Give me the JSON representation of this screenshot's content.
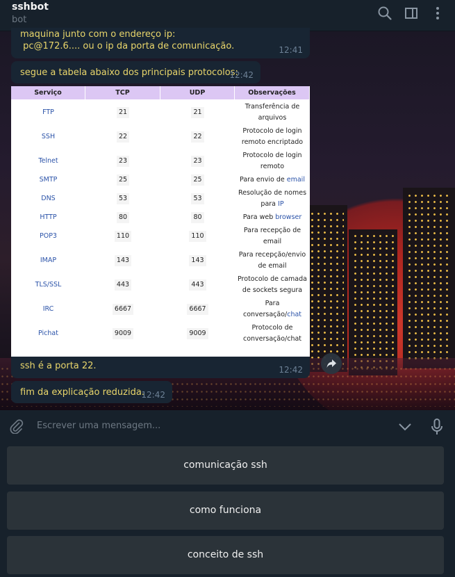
{
  "header": {
    "title": "sshbot",
    "subtitle": "bot"
  },
  "messages": [
    {
      "text": "maquina junto com o endereço ip:\n pc@172.6.... ou o ip da porta de comunicação.",
      "time": "12:41"
    },
    {
      "text": "segue a tabela abaixo dos principais protocolos:",
      "time": "12:42"
    },
    {
      "text": "ssh é a porta 22.",
      "time": "12:42"
    },
    {
      "text": "fim da explicação reduzida.",
      "time": "12:42"
    }
  ],
  "table": {
    "headers": [
      "Serviço",
      "TCP",
      "UDP",
      "Observações"
    ],
    "rows": [
      {
        "service": "FTP",
        "tcp": "21",
        "udp": "21",
        "obs1": "Transferência de",
        "obs2": "arquivos",
        "obs_link": ""
      },
      {
        "service": "SSH",
        "tcp": "22",
        "udp": "22",
        "obs1": "Protocolo de login",
        "obs2": "remoto encriptado",
        "obs_link": ""
      },
      {
        "service": "Telnet",
        "tcp": "23",
        "udp": "23",
        "obs1": "Protocolo de login",
        "obs2": "remoto",
        "obs_link": ""
      },
      {
        "service": "SMTP",
        "tcp": "25",
        "udp": "25",
        "obs1": "Para envio de ",
        "obs2": "",
        "obs_link": "email"
      },
      {
        "service": "DNS",
        "tcp": "53",
        "udp": "53",
        "obs1": "Resolução de nomes",
        "obs2": "para ",
        "obs_link": "IP"
      },
      {
        "service": "HTTP",
        "tcp": "80",
        "udp": "80",
        "obs1": "Para web ",
        "obs2": "",
        "obs_link": "browser"
      },
      {
        "service": "POP3",
        "tcp": "110",
        "udp": "110",
        "obs1": "Para recepção de",
        "obs2": "email",
        "obs_link": ""
      },
      {
        "service": "IMAP",
        "tcp": "143",
        "udp": "143",
        "obs1": "Para recepção/envio",
        "obs2": "de email",
        "obs_link": ""
      },
      {
        "service": "TLS/SSL",
        "tcp": "443",
        "udp": "443",
        "obs1": "Protocolo de camada",
        "obs2": "de sockets segura",
        "obs_link": ""
      },
      {
        "service": "IRC",
        "tcp": "6667",
        "udp": "6667",
        "obs1": "Para",
        "obs2": "conversação/",
        "obs_link": "chat"
      },
      {
        "service": "Pichat",
        "tcp": "9009",
        "udp": "9009",
        "obs1": "Protocolo de",
        "obs2": "conversação/chat",
        "obs_link": ""
      }
    ]
  },
  "composer": {
    "placeholder": "Escrever uma mensagem..."
  },
  "keyboard": {
    "buttons": [
      "comunicação ssh",
      "como funciona",
      "conceito de ssh"
    ]
  },
  "icons": [
    "search-icon",
    "sidebar-toggle-icon",
    "more-vertical-icon",
    "forward-icon",
    "attach-icon",
    "chevron-down-icon",
    "microphone-icon"
  ],
  "colors": {
    "accent_text": "#e9d66b",
    "bubble": "#182533",
    "table_header": "#dcc7f4",
    "link": "#2a52a8"
  }
}
